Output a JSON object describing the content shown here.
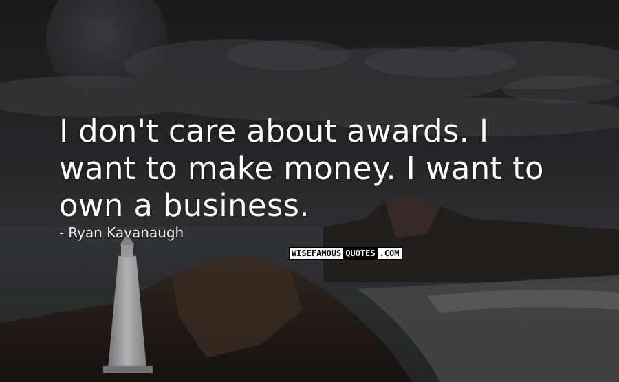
{
  "quote": {
    "lines": [
      "I don't care about awards. I",
      "want to make money. I want to",
      "own a business."
    ]
  },
  "author": {
    "dash": "-",
    "name": "Ryan Kavanaugh"
  },
  "watermark": {
    "part1": "WISEFAMOUS",
    "part2": "QUOTES",
    "part3": ".COM"
  },
  "colors": {
    "text": "#ffffff",
    "sky": "#2a2c2f",
    "sea": "#3a3d40"
  }
}
